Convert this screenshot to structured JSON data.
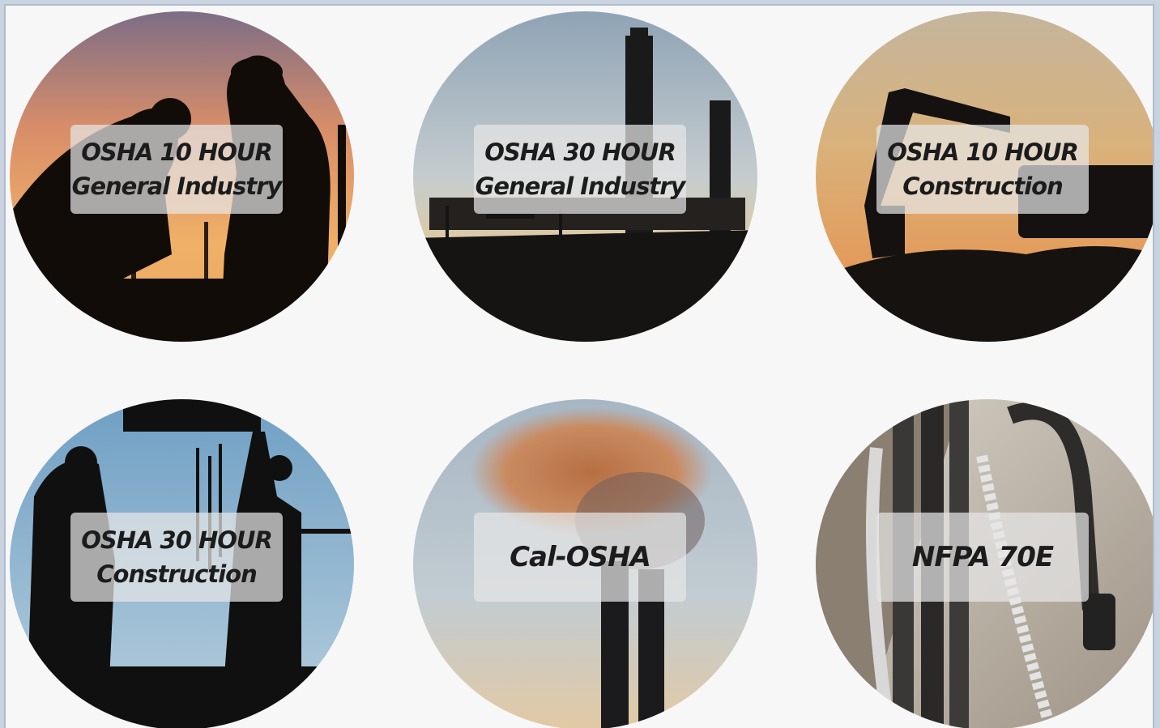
{
  "courses": [
    {
      "line1": "OSHA 10 HOUR",
      "line2": "General Industry"
    },
    {
      "line1": "OSHA 30 HOUR",
      "line2": "General Industry"
    },
    {
      "line1": "OSHA 10 HOUR",
      "line2": "Construction"
    },
    {
      "line1": "OSHA 30 HOUR",
      "line2": "Construction"
    },
    {
      "line1": "Cal-OSHA"
    },
    {
      "line1": "NFPA 70E"
    }
  ],
  "colors": {
    "page_background": "#f7f7f8",
    "frame_border": "#aebbd0",
    "label_background": "#e6e6e6",
    "label_text": "#1c1c1c"
  }
}
